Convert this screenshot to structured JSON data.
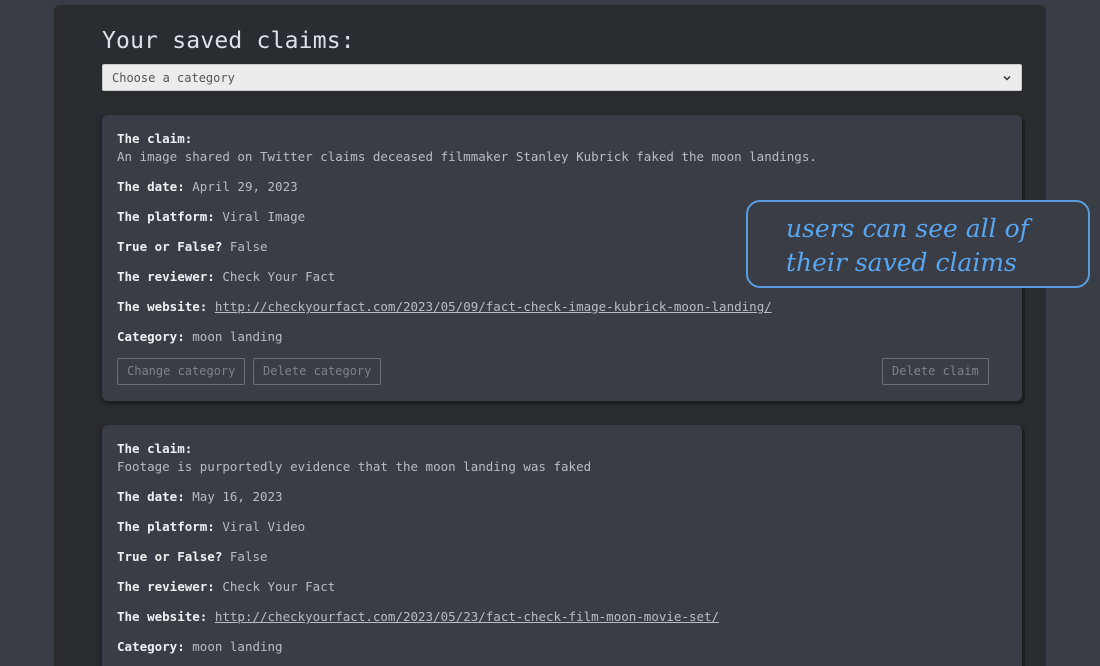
{
  "page": {
    "heading": "Your saved claims:"
  },
  "category_select": {
    "selected": "Choose a category",
    "icon": "chevron-down-icon"
  },
  "labels": {
    "claim": "The claim:",
    "date": "The date:",
    "platform": "The platform:",
    "verdict": "True or False?",
    "reviewer": "The reviewer:",
    "website": "The website:",
    "category": "Category:"
  },
  "claims": [
    {
      "claim": "An image shared on Twitter claims deceased filmmaker Stanley Kubrick faked the moon landings.",
      "date": "April 29, 2023",
      "platform": "Viral Image",
      "verdict": "False",
      "reviewer": "Check Your Fact",
      "website": "http://checkyourfact.com/2023/05/09/fact-check-image-kubrick-moon-landing/",
      "category": "moon landing",
      "buttons": {
        "change_category": "Change category",
        "delete_category": "Delete category",
        "delete_claim": "Delete claim"
      }
    },
    {
      "claim": "Footage is purportedly evidence that the moon landing was faked",
      "date": "May 16, 2023",
      "platform": "Viral Video",
      "verdict": "False",
      "reviewer": "Check Your Fact",
      "website": "http://checkyourfact.com/2023/05/23/fact-check-film-moon-movie-set/",
      "category": "moon landing"
    }
  ],
  "annotation": {
    "text": "users can see all of their saved claims",
    "color": "#5a9be0"
  }
}
